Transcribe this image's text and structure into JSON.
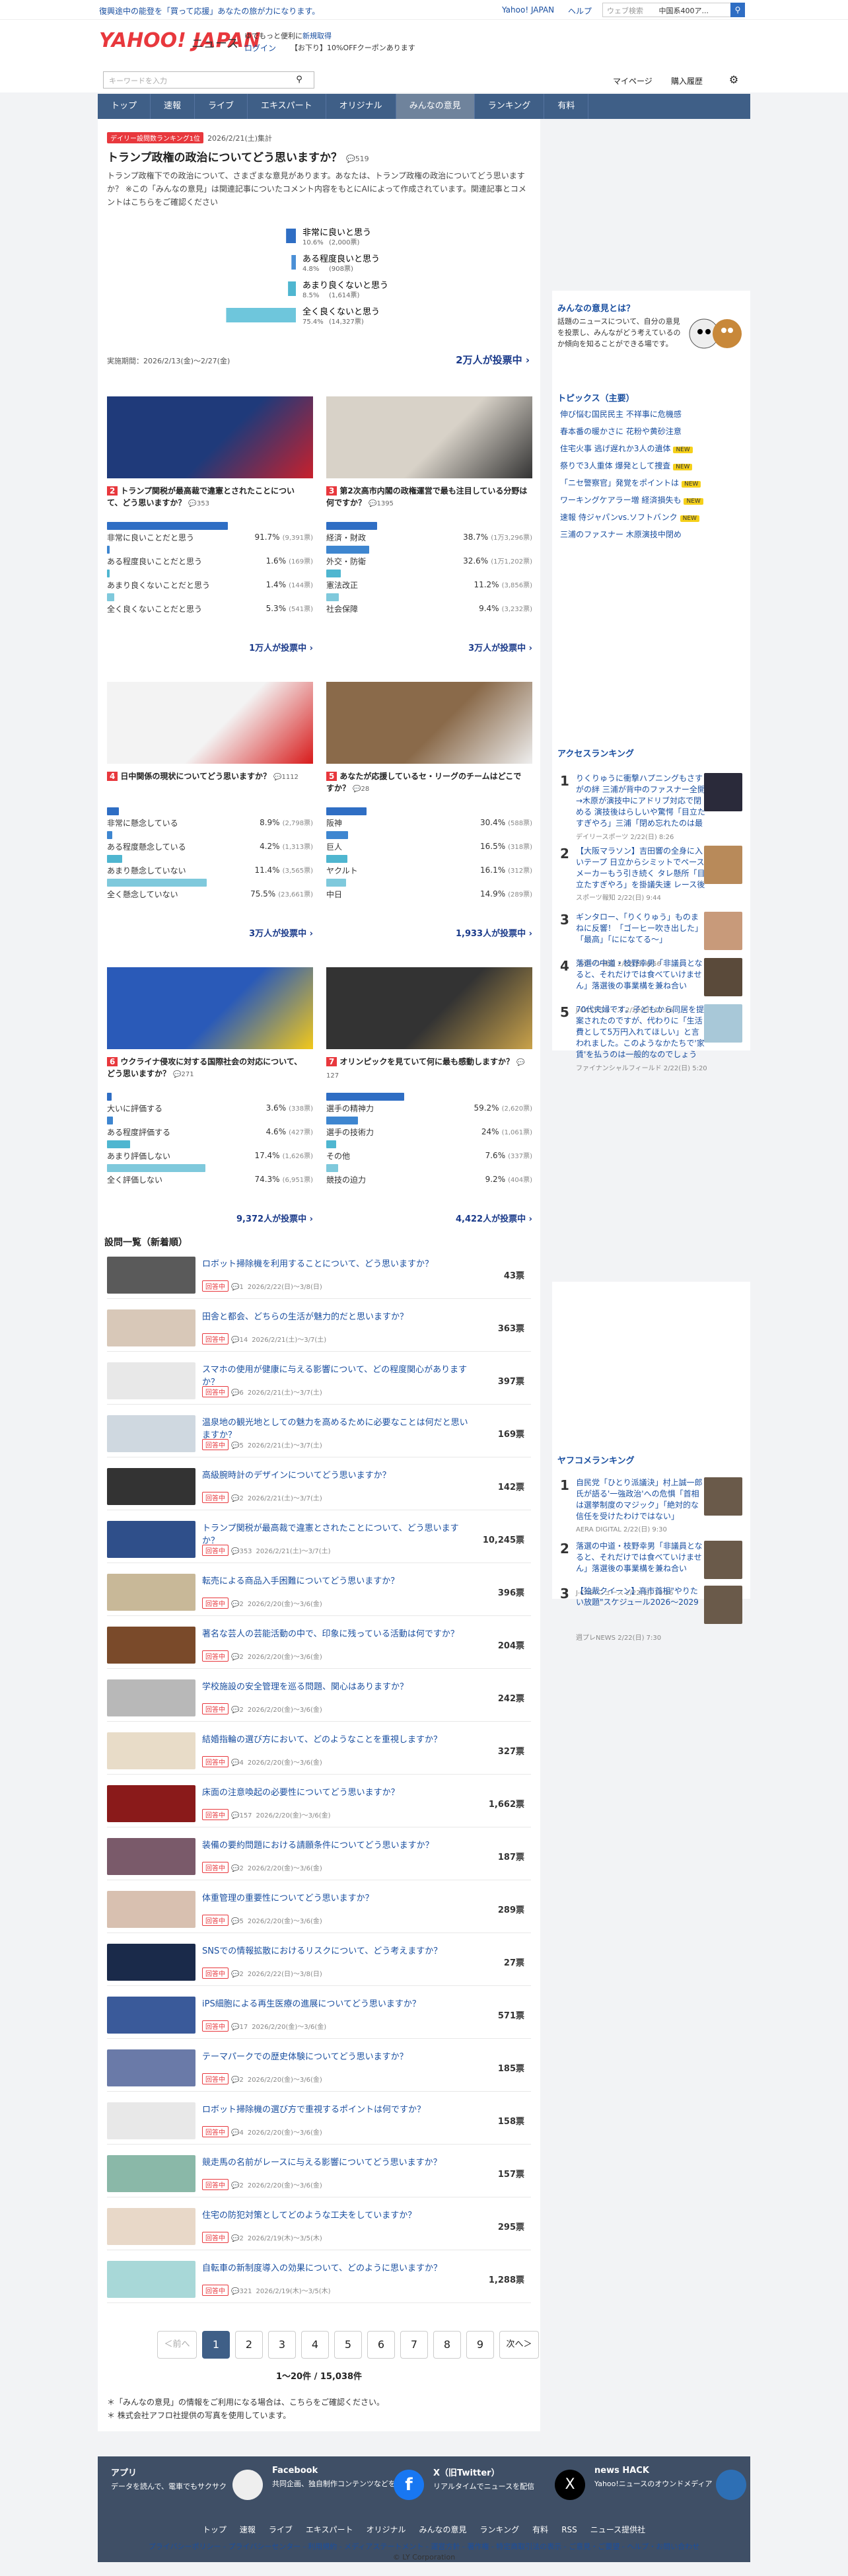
{
  "topbar": {
    "notice": "復興途中の能登を「買って応援」あなたの旅が力になります。",
    "links": [
      "Yahoo! JAPAN",
      "ヘルプ"
    ],
    "search_placeholder": "ウェブ検索",
    "search_value": "中国系400ア..."
  },
  "header": {
    "logo": "YAHOO! JAPAN",
    "logo_sub": "ニュース",
    "promo1": "ゆでもっと便利に",
    "promo_link": "新規取得",
    "login": "ログイン",
    "coupon": "【お下り】10%OFFクーポンあります",
    "search_placeholder": "キーワードを入力",
    "mypage": "マイページ",
    "history": "購入履歴"
  },
  "nav": [
    "トップ",
    "速報",
    "ライブ",
    "エキスパート",
    "オリジナル",
    "みんなの意見",
    "ランキング",
    "有料"
  ],
  "hero": {
    "badge": "デイリー設問数ランキング1位",
    "date": "2026/2/21(土)集計",
    "title": "トランプ政権の政治についてどう思いますか？",
    "comments": "519",
    "desc": "トランプ政権下での政治について、さまざまな意見があります。あなたは、トランプ政権の政治についてどう思いますか？ ※この「みんなの意見」は関連記事についたコメント内容をもとにAIによって作成されています。関連記事とコメントはこちらをご確認ください",
    "options": [
      {
        "label": "非常に良いと思う",
        "pct": "10.6%",
        "votes": "(2,000票)",
        "value": 10.6,
        "color": "#2f6ec4"
      },
      {
        "label": "ある程度良いと思う",
        "pct": "4.8%",
        "votes": "(908票)",
        "value": 4.8,
        "color": "#4a8fd6"
      },
      {
        "label": "あまり良くないと思う",
        "pct": "8.5%",
        "votes": "(1,614票)",
        "value": 8.5,
        "color": "#4fb6d0"
      },
      {
        "label": "全く良くないと思う",
        "pct": "75.4%",
        "votes": "(14,327票)",
        "value": 75.4,
        "color": "#6ec6dc"
      }
    ],
    "period": "実施期間：2026/2/13(金)〜2/27(金)",
    "total": "2万人が投票中"
  },
  "cards": [
    {
      "num": "2",
      "title": "トランプ関税が最高裁で違憲とされたことについて、どう思いますか？",
      "comments": "353",
      "options": [
        {
          "label": "非常に良いことだと思う",
          "pct": "91.7%",
          "votes": "(9,391票)",
          "value": 91.7
        },
        {
          "label": "ある程度良いことだと思う",
          "pct": "1.6%",
          "votes": "(169票)",
          "value": 1.6
        },
        {
          "label": "あまり良くないことだと思う",
          "pct": "1.4%",
          "votes": "(144票)",
          "value": 1.4
        },
        {
          "label": "全く良くないことだと思う",
          "pct": "5.3%",
          "votes": "(541票)",
          "value": 5.3
        }
      ],
      "total": "1万人が投票中"
    },
    {
      "num": "3",
      "title": "第2次高市内閣の政権運営で最も注目している分野は何ですか？",
      "comments": "1395",
      "options": [
        {
          "label": "経済・財政",
          "pct": "38.7%",
          "votes": "(1万3,296票)",
          "value": 38.7
        },
        {
          "label": "外交・防衛",
          "pct": "32.6%",
          "votes": "(1万1,202票)",
          "value": 32.6
        },
        {
          "label": "憲法改正",
          "pct": "11.2%",
          "votes": "(3,856票)",
          "value": 11.2
        },
        {
          "label": "社会保障",
          "pct": "9.4%",
          "votes": "(3,232票)",
          "value": 9.4
        }
      ],
      "total": "3万人が投票中"
    },
    {
      "num": "4",
      "title": "日中関係の現状についてどう思いますか？",
      "comments": "1112",
      "options": [
        {
          "label": "非常に懸念している",
          "pct": "8.9%",
          "votes": "(2,798票)",
          "value": 8.9
        },
        {
          "label": "ある程度懸念している",
          "pct": "4.2%",
          "votes": "(1,313票)",
          "value": 4.2
        },
        {
          "label": "あまり懸念していない",
          "pct": "11.4%",
          "votes": "(3,565票)",
          "value": 11.4
        },
        {
          "label": "全く懸念していない",
          "pct": "75.5%",
          "votes": "(23,661票)",
          "value": 75.5
        }
      ],
      "total": "3万人が投票中"
    },
    {
      "num": "5",
      "title": "あなたが応援しているセ・リーグのチームはどこですか？",
      "comments": "28",
      "options": [
        {
          "label": "阪神",
          "pct": "30.4%",
          "votes": "(588票)",
          "value": 30.4
        },
        {
          "label": "巨人",
          "pct": "16.5%",
          "votes": "(318票)",
          "value": 16.5
        },
        {
          "label": "ヤクルト",
          "pct": "16.1%",
          "votes": "(312票)",
          "value": 16.1
        },
        {
          "label": "中日",
          "pct": "14.9%",
          "votes": "(289票)",
          "value": 14.9
        }
      ],
      "total": "1,933人が投票中"
    },
    {
      "num": "6",
      "title": "ウクライナ侵攻に対する国際社会の対応について、どう思いますか？",
      "comments": "271",
      "options": [
        {
          "label": "大いに評価する",
          "pct": "3.6%",
          "votes": "(338票)",
          "value": 3.6
        },
        {
          "label": "ある程度評価する",
          "pct": "4.6%",
          "votes": "(427票)",
          "value": 4.6
        },
        {
          "label": "あまり評価しない",
          "pct": "17.4%",
          "votes": "(1,626票)",
          "value": 17.4
        },
        {
          "label": "全く評価しない",
          "pct": "74.3%",
          "votes": "(6,951票)",
          "value": 74.3
        }
      ],
      "total": "9,372人が投票中"
    },
    {
      "num": "7",
      "title": "オリンピックを見ていて何に最も感動しますか？",
      "comments": "127",
      "options": [
        {
          "label": "選手の精神力",
          "pct": "59.2%",
          "votes": "(2,620票)",
          "value": 59.2
        },
        {
          "label": "選手の技術力",
          "pct": "24%",
          "votes": "(1,061票)",
          "value": 24
        },
        {
          "label": "その他",
          "pct": "7.6%",
          "votes": "(337票)",
          "value": 7.6
        },
        {
          "label": "競技の迫力",
          "pct": "9.2%",
          "votes": "(404票)",
          "value": 9.2
        }
      ],
      "total": "4,422人が投票中"
    }
  ],
  "list": {
    "heading": "設問一覧（新着順）",
    "tag": "回答中",
    "items": [
      {
        "q": "ロボット掃除機を利用することについて、どう思いますか？",
        "c": "1",
        "d": "2026/2/22(日)〜3/8(日)",
        "v": "43票"
      },
      {
        "q": "田舎と都会、どちらの生活が魅力的だと思いますか？",
        "c": "14",
        "d": "2026/2/21(土)〜3/7(土)",
        "v": "363票"
      },
      {
        "q": "スマホの使用が健康に与える影響について、どの程度関心がありますか？",
        "c": "6",
        "d": "2026/2/21(土)〜3/7(土)",
        "v": "397票"
      },
      {
        "q": "温泉地の観光地としての魅力を高めるために必要なことは何だと思いますか？",
        "c": "5",
        "d": "2026/2/21(土)〜3/7(土)",
        "v": "169票"
      },
      {
        "q": "高級腕時計のデザインについてどう思いますか？",
        "c": "2",
        "d": "2026/2/21(土)〜3/7(土)",
        "v": "142票"
      },
      {
        "q": "トランプ関税が最高裁で違憲とされたことについて、どう思いますか？",
        "c": "353",
        "d": "2026/2/21(土)〜3/7(土)",
        "v": "10,245票"
      },
      {
        "q": "転売による商品入手困難についてどう思いますか？",
        "c": "2",
        "d": "2026/2/20(金)〜3/6(金)",
        "v": "396票"
      },
      {
        "q": "著名な芸人の芸能活動の中で、印象に残っている活動は何ですか？",
        "c": "2",
        "d": "2026/2/20(金)〜3/6(金)",
        "v": "204票"
      },
      {
        "q": "学校施設の安全管理を巡る問題、関心はありますか？",
        "c": "2",
        "d": "2026/2/20(金)〜3/6(金)",
        "v": "242票"
      },
      {
        "q": "結婚指輪の選び方において、どのようなことを重視しますか？",
        "c": "4",
        "d": "2026/2/20(金)〜3/6(金)",
        "v": "327票"
      },
      {
        "q": "床面の注意喚起の必要性についてどう思いますか？",
        "c": "157",
        "d": "2026/2/20(金)〜3/6(金)",
        "v": "1,662票"
      },
      {
        "q": "装備の要約問題における請願条件についてどう思いますか？",
        "c": "2",
        "d": "2026/2/20(金)〜3/6(金)",
        "v": "187票"
      },
      {
        "q": "体重管理の重要性についてどう思いますか？",
        "c": "5",
        "d": "2026/2/20(金)〜3/6(金)",
        "v": "289票"
      },
      {
        "q": "SNSでの情報拡散におけるリスクについて、どう考えますか？",
        "c": "2",
        "d": "2026/2/22(日)〜3/8(日)",
        "v": "27票"
      },
      {
        "q": "iPS細胞による再生医療の進展についてどう思いますか？",
        "c": "17",
        "d": "2026/2/20(金)〜3/6(金)",
        "v": "571票"
      },
      {
        "q": "テーマパークでの歴史体験についてどう思いますか？",
        "c": "2",
        "d": "2026/2/20(金)〜3/6(金)",
        "v": "185票"
      },
      {
        "q": "ロボット掃除機の選び方で重視するポイントは何ですか？",
        "c": "4",
        "d": "2026/2/20(金)〜3/6(金)",
        "v": "158票"
      },
      {
        "q": "競走馬の名前がレースに与える影響についてどう思いますか？",
        "c": "2",
        "d": "2026/2/20(金)〜3/6(金)",
        "v": "157票"
      },
      {
        "q": "住宅の防犯対策としてどのような工夫をしていますか？",
        "c": "2",
        "d": "2026/2/19(木)〜3/5(木)",
        "v": "295票"
      },
      {
        "q": "自転車の新制度導入の効果について、どのように思いますか？",
        "c": "321",
        "d": "2026/2/19(木)〜3/5(木)",
        "v": "1,288票"
      }
    ]
  },
  "pager": {
    "prev": "＜前へ",
    "pages": [
      "1",
      "2",
      "3",
      "4",
      "5",
      "6",
      "7",
      "8",
      "9"
    ],
    "next": "次へ＞",
    "summary": "1〜20件 / 15,038件"
  },
  "notes": [
    "＊「みんなの意見」の情報をご利用になる場合は、こちらをご確認ください。",
    "＊ 株式会社アフロ社提供の写真を使用しています。"
  ],
  "side": {
    "about_title": "みんなの意見とは？",
    "about_text": "話題のニュースについて、自分の意見を投票し、みんながどう考えているのか傾向を知ることができる場です。",
    "topics_title": "トピックス（主要）",
    "topics": [
      {
        "t": "伸び悩む国民民主 不祥事に危機感",
        "tag": ""
      },
      {
        "t": "春本番の暖かさに 花粉や黄砂注意",
        "tag": ""
      },
      {
        "t": "住宅火事 逃げ遅れか3人の遺体",
        "tag": "NEW"
      },
      {
        "t": "祭りで3人重体 爆発として捜査",
        "tag": "NEW"
      },
      {
        "t": "「ニセ警察官」発覚をポイントは",
        "tag": "NEW"
      },
      {
        "t": "ワーキングケアラー増 経済損失も",
        "tag": "NEW"
      },
      {
        "t": "速報 侍ジャパンvs.ソフトバンク",
        "tag": "NEW"
      },
      {
        "t": "三浦のファスナー 木原演技中閉め",
        "tag": ""
      }
    ],
    "access_title": "アクセスランキング",
    "access": [
      {
        "n": "1",
        "t": "りくりゅうに衝撃ハプニングもさすがの絆 三浦が背中のファスナー全開→木原が演技中にアドリブ対応で閉める 演技後はらしいや驚愕「目立たすぎやろ」三浦「閉め忘れたのは最後」木原「今日は僕がお兄さんでした」",
        "s": "デイリースポーツ 2/22(日) 8:26"
      },
      {
        "n": "2",
        "t": "【大阪マラソン】吉田響の全身に入いテープ 日立からシミットでペースメーカーもう引き続く タレ懸所「目立たすぎやろ」を掛議失速 レース後に車椅子で救護室へ",
        "s": "スポーツ報知 2/22(日) 9:44"
      },
      {
        "n": "3",
        "t": "ギンタロー、「りくりゅう」ものまねに反響！「ゴーヒー吹き出した」「最高」「にになてる〜」",
        "s": "スポーツ報知 2/22(日) 6:56"
      },
      {
        "n": "4",
        "t": "落選の中道・枝野幸男「非議員となると、それだけでは食べていけません」落選後の事業構を兼ね合い",
        "s": "J-CASTニュース 2/22(日) 10:26"
      },
      {
        "n": "5",
        "t": "70代夫婦です。子どもから同居を提案されたのですが、代わりに「生活費として5万円入れてほしい」と言われました。このようなかたちで'家賃'を払うのは一般的なのでしょうか？",
        "s": "ファイナンシャルフィールド 2/22(日) 5:20"
      }
    ],
    "yahoo_title": "ヤフコメランキング",
    "yahoo": [
      {
        "n": "1",
        "t": "自民党「ひとり派議決」村上誠一郎氏が語る'一強政治'への危惧「首相は選挙制度のマジック」「絶対的な信任を受けたわけではない」",
        "s": "AERA DIGITAL 2/22(日) 9:30"
      },
      {
        "n": "2",
        "t": "落選の中道・枝野幸男「非議員となると、それだけでは食べていけません」落選後の事業構を兼ね合い",
        "s": "J-CASTニュース 2/22(日) 10:26"
      },
      {
        "n": "3",
        "t": "【独裁クイーン】高市首相\"やりたい放題\"スケジュール2026〜2029",
        "s": "週プレNEWS 2/22(日) 7:30"
      }
    ]
  },
  "footer": {
    "boxes": [
      {
        "title": "アプリ",
        "text": "データを読んで、電車でもサクサク"
      },
      {
        "title": "Facebook",
        "text": "共同企画、独自制作コンテンツなどを投稿"
      },
      {
        "title": "X（旧Twitter）",
        "text": "リアルタイムでニュースを配信"
      },
      {
        "title": "news HACK",
        "text": "Yahoo!ニュースのオウンドメディア"
      }
    ],
    "nav": [
      "トップ",
      "速報",
      "ライブ",
      "エキスパート",
      "オリジナル",
      "みんなの意見",
      "ランキング",
      "有料",
      "RSS",
      "ニュース提供社"
    ],
    "legal": "プライバシーポリシー - プライバシーセンター - 利用規約 - メディアステートメント - 運営方針 - 著作権 - 特定商取引法の表示 - ご意見・ご要望 - ヘルプ・お問い合わせ",
    "copy": "© LY Corporation"
  }
}
